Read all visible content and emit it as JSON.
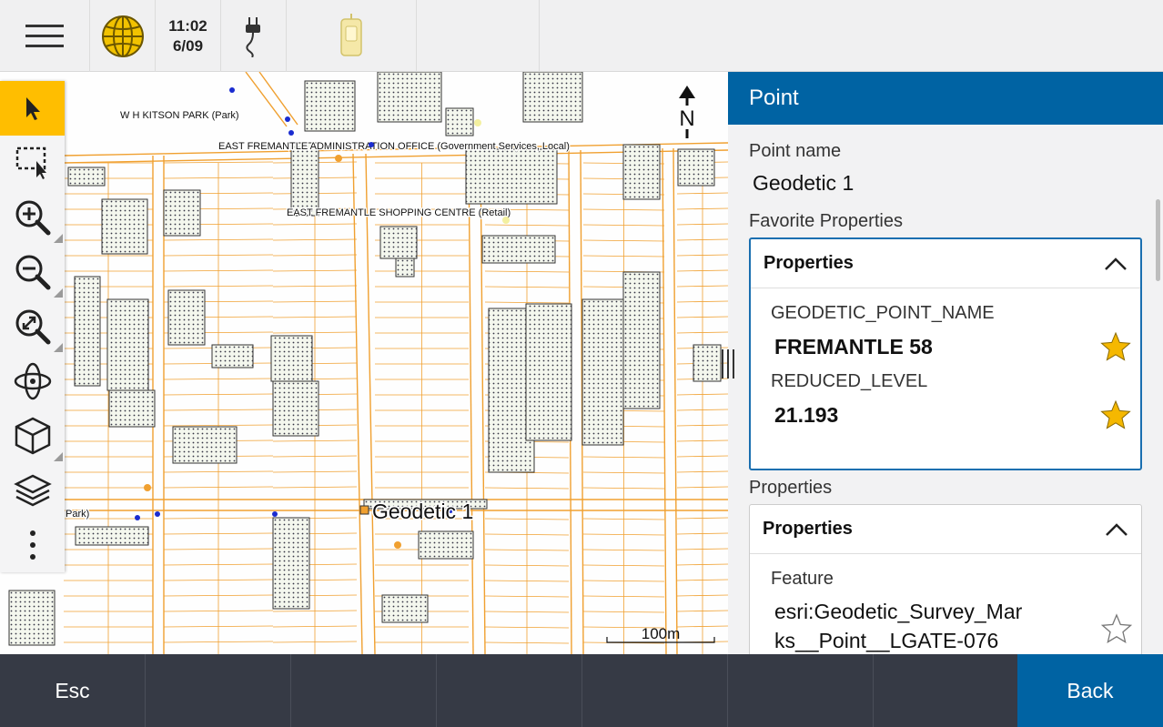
{
  "status": {
    "menu_icon": "hamburger-icon",
    "globe_icon": "globe-icon",
    "time": "11:02",
    "date": "6/09",
    "power_icon": "power-plug-icon",
    "receiver_icon": "receiver-icon"
  },
  "map": {
    "north_label": "N",
    "scale_label": "100m",
    "selected_point_label": "Geodetic 1",
    "labels": {
      "park1": "W H KITSON PARK (Park)",
      "admin": "EAST FREMANTLE ADMINISTRATION OFFICE (Government Services, Local)",
      "shopping": "EAST FREMANTLE SHOPPING CENTRE (Retail)",
      "park2": "Park)"
    }
  },
  "toolbar": {
    "tools": [
      {
        "name": "select-arrow-icon",
        "active": true
      },
      {
        "name": "select-box-icon",
        "active": false
      },
      {
        "name": "zoom-in-icon",
        "active": false
      },
      {
        "name": "zoom-out-icon",
        "active": false
      },
      {
        "name": "zoom-extents-icon",
        "active": false
      },
      {
        "name": "orbit-icon",
        "active": false
      },
      {
        "name": "cube-view-icon",
        "active": false
      },
      {
        "name": "layers-icon",
        "active": false
      },
      {
        "name": "more-vertical-icon",
        "active": false
      }
    ]
  },
  "panel": {
    "title": "Point",
    "point_name_label": "Point name",
    "point_name": "Geodetic 1",
    "favorites_label": "Favorite Properties",
    "favorites_card_title": "Properties",
    "favorites": [
      {
        "key": "GEODETIC_POINT_NAME",
        "value": "FREMANTLE 58",
        "starred": true
      },
      {
        "key": "REDUCED_LEVEL",
        "value": "21.193",
        "starred": true
      }
    ],
    "properties_label": "Properties",
    "properties_card_title": "Properties",
    "feature_key": "Feature",
    "feature_value_line1": "esri:Geodetic_Survey_Mar",
    "feature_value_line2": "ks__Point__LGATE-076",
    "feature_starred": false
  },
  "bottom": {
    "esc_label": "Esc",
    "back_label": "Back"
  },
  "colors": {
    "accent": "#0063a3",
    "star": "#f5b800",
    "tool_active": "#ffbe00",
    "parcel_line": "#f0a030"
  }
}
